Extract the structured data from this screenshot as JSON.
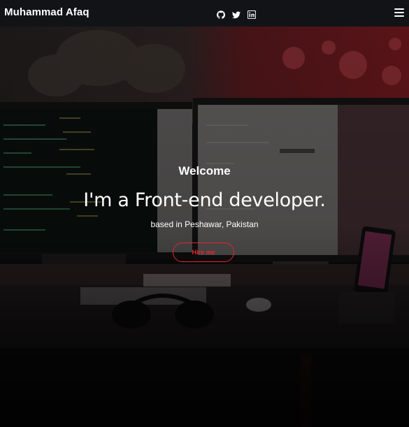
{
  "navbar": {
    "brand": "Muhammad Afaq",
    "social_icons": [
      "github-icon",
      "twitter-icon",
      "linkedin-icon"
    ],
    "menu_icon": "hamburger-menu-icon"
  },
  "hero": {
    "greeting": "Welcome",
    "headline": "I'm a Front-end developer.",
    "location": "based in Peshawar, Pakistan",
    "cta_label": "Hire me"
  },
  "colors": {
    "navbar_bg": "#121317",
    "accent": "#e3262e",
    "text": "#ffffff"
  }
}
